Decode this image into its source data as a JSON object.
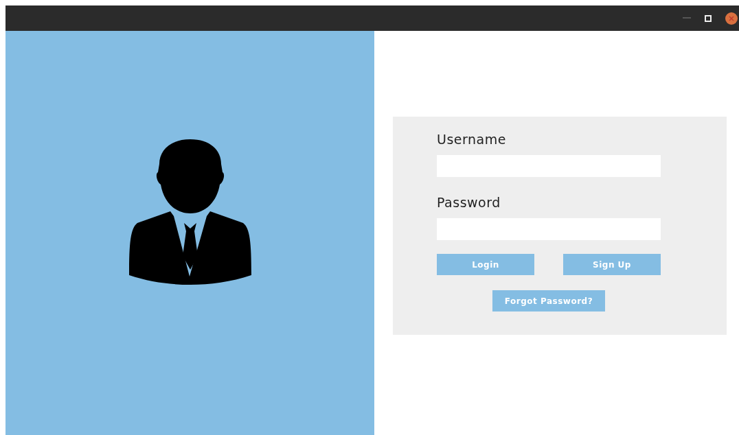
{
  "login_form": {
    "fields": [
      {
        "label": "Username"
      },
      {
        "label": "Password"
      }
    ],
    "buttons": [
      {
        "label": "Login",
        "kind": "primary"
      },
      {
        "label": "Sign Up",
        "kind": "primary"
      }
    ],
    "forgot_link": {
      "label": "Forgot Password?"
    }
  }
}
